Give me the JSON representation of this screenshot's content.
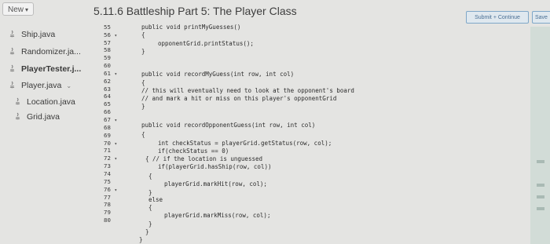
{
  "header": {
    "new_label": "New",
    "title": "5.11.6 Battleship Part 5: The Player Class",
    "submit_label": "Submit + Continue",
    "save_label": "Save"
  },
  "sidebar": {
    "files": [
      {
        "name": "Ship.java"
      },
      {
        "name": "Randomizer.ja..."
      },
      {
        "name": "PlayerTester.j..."
      },
      {
        "name": "Player.java"
      },
      {
        "name": "Location.java"
      },
      {
        "name": "Grid.java"
      }
    ]
  },
  "editor": {
    "line_numbers": [
      "55",
      "56",
      "57",
      "58",
      "59",
      "60",
      "61",
      "62",
      "63",
      "64",
      "65",
      "66",
      "67",
      "68",
      "69",
      "70",
      "71",
      "72",
      "73",
      "74",
      "75",
      "76",
      "77",
      "78",
      "79",
      "80"
    ],
    "code_lines": [
      "public void printMyGuesses()",
      "{",
      "opponentGrid.printStatus();",
      "}",
      "",
      "public void recordMyGuess(int row, int col)",
      "{",
      "// this will eventually need to look at the opponent's board",
      "// and mark a hit or miss on this player's opponentGrid",
      "}",
      "",
      "public void recordOpponentGuess(int row, int col)",
      "{",
      "int checkStatus = playerGrid.getStatus(row, col);",
      "if(checkStatus == 0)",
      "{ // if the location is unguessed",
      "if(playerGrid.hasShip(row, col))",
      "{",
      "playerGrid.markHit(row, col);",
      "}",
      "else",
      "{",
      "playerGrid.markMiss(row, col);",
      "}",
      "}",
      "}"
    ]
  }
}
